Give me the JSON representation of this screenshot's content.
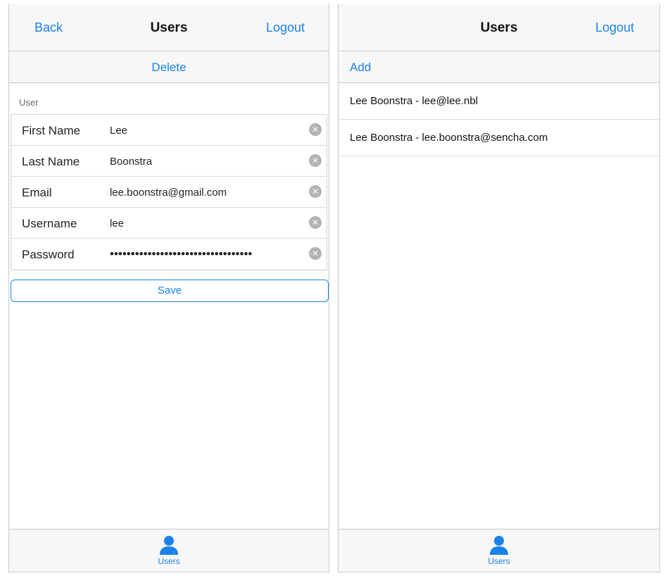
{
  "colors": {
    "accent": "#1a82e8",
    "bar_background": "#f7f7f7",
    "clear_icon": "#b3b3b3"
  },
  "left_screen": {
    "navbar": {
      "back_label": "Back",
      "title": "Users",
      "logout_label": "Logout"
    },
    "toolbar": {
      "delete_label": "Delete"
    },
    "form": {
      "fieldset_title": "User",
      "fields": [
        {
          "label": "First Name",
          "value": "Lee"
        },
        {
          "label": "Last Name",
          "value": "Boonstra"
        },
        {
          "label": "Email",
          "value": "lee.boonstra@gmail.com"
        },
        {
          "label": "Username",
          "value": "lee"
        },
        {
          "label": "Password",
          "value": "••••••••••••••••••••••••••••••••••"
        }
      ],
      "clear_icon": "clear-icon",
      "save_label": "Save"
    },
    "tabbar": {
      "tab_label": "Users",
      "tab_icon": "user-icon"
    }
  },
  "right_screen": {
    "navbar": {
      "title": "Users",
      "logout_label": "Logout"
    },
    "toolbar": {
      "add_label": "Add"
    },
    "list": [
      {
        "text": "Lee Boonstra - lee@lee.nbl"
      },
      {
        "text": "Lee Boonstra - lee.boonstra@sencha.com"
      }
    ],
    "tabbar": {
      "tab_label": "Users",
      "tab_icon": "user-icon"
    }
  }
}
